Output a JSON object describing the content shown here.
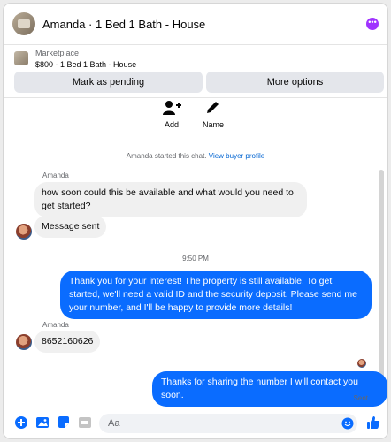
{
  "header": {
    "title": "Amanda · 1 Bed 1 Bath - House"
  },
  "listing": {
    "source": "Marketplace",
    "price_title": "$800 - 1 Bed 1 Bath - House",
    "buttons": {
      "pending": "Mark as pending",
      "options": "More options"
    }
  },
  "actions": [
    {
      "label": "Add",
      "icon": "person-add-icon"
    },
    {
      "label": "Name",
      "icon": "pencil-icon"
    }
  ],
  "system": {
    "started": "Amanda started this chat.",
    "link": "View buyer profile"
  },
  "messages": [
    {
      "sender": "Amanda",
      "text": "how soon could this be available and what would you need to get started?"
    },
    {
      "text": "Message sent"
    },
    {
      "time": "9:50 PM"
    },
    {
      "text": "Thank you for your interest! The property is still available. To get started, we'll need a valid ID and the security deposit. Please send me your number, and I'll be happy to provide more details!"
    },
    {
      "sender": "Amanda",
      "text": "8652160626"
    },
    {
      "text": "Thanks for sharing the number I will contact you soon."
    }
  ],
  "status": "Sent",
  "composer": {
    "placeholder": "Aa"
  },
  "colors": {
    "accent": "#0a6cff",
    "incoming": "#f0f0f0",
    "more": "#a033ff"
  }
}
